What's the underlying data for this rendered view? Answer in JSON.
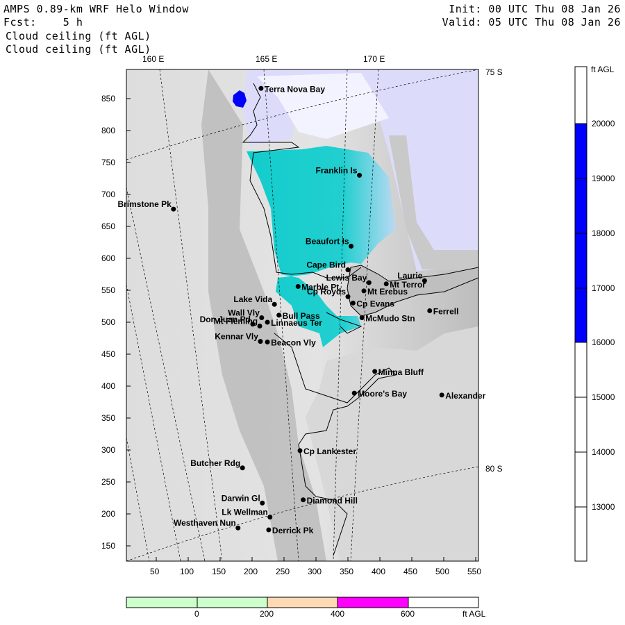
{
  "header": {
    "title": "AMPS 0.89-km WRF Helo Window",
    "forecast": "Fcst:    5 h",
    "field_line1": "Cloud ceiling (ft AGL)",
    "field_line2": "Cloud ceiling (ft AGL)",
    "init": "Init: 00 UTC Thu 08 Jan 26",
    "valid": "Valid: 05 UTC Thu 08 Jan 26"
  },
  "map": {
    "x_ticks": [
      "50",
      "100",
      "150",
      "200",
      "250",
      "300",
      "350",
      "400",
      "450",
      "500",
      "550"
    ],
    "y_ticks": [
      "850",
      "800",
      "750",
      "700",
      "650",
      "600",
      "550",
      "500",
      "450",
      "400",
      "350",
      "300",
      "250",
      "200",
      "150"
    ],
    "lon_labels": [
      "160 E",
      "165 E",
      "170 E"
    ],
    "lat_labels": [
      "75 S",
      "80 S"
    ],
    "places": [
      {
        "name": "Terra Nova Bay",
        "x": 214,
        "y": 866
      },
      {
        "name": "Franklin Is",
        "x": 368,
        "y": 730
      },
      {
        "name": "Brimstone Pk",
        "x": 77,
        "y": 677
      },
      {
        "name": "Beaufort Is",
        "x": 355,
        "y": 619
      },
      {
        "name": "Cape Bird",
        "x": 350,
        "y": 582
      },
      {
        "name": "Lewis Bay",
        "x": 383,
        "y": 562
      },
      {
        "name": "Laurie",
        "x": 470,
        "y": 565
      },
      {
        "name": "Mt Terror",
        "x": 410,
        "y": 560
      },
      {
        "name": "Marble Pt",
        "x": 272,
        "y": 556
      },
      {
        "name": "Mt Erebus",
        "x": 375,
        "y": 549
      },
      {
        "name": "Cp Royds",
        "x": 350,
        "y": 540
      },
      {
        "name": "Lake Vida",
        "x": 235,
        "y": 528
      },
      {
        "name": "Cp Evans",
        "x": 358,
        "y": 530
      },
      {
        "name": "Ferrell",
        "x": 478,
        "y": 518
      },
      {
        "name": "Wall Vly",
        "x": 215,
        "y": 507
      },
      {
        "name": "Bull Pass",
        "x": 242,
        "y": 511
      },
      {
        "name": "McMudo Stn",
        "x": 372,
        "y": 507
      },
      {
        "name": "Don Juan Pd",
        "x": 201,
        "y": 497
      },
      {
        "name": "Mt Fleming",
        "x": 212,
        "y": 494
      },
      {
        "name": "Linnaeus Ter",
        "x": 224,
        "y": 500
      },
      {
        "name": "Kennar Vly",
        "x": 213,
        "y": 470
      },
      {
        "name": "Beacon Vly",
        "x": 224,
        "y": 469
      },
      {
        "name": "Minna Bluff",
        "x": 392,
        "y": 423
      },
      {
        "name": "Moore's Bay",
        "x": 360,
        "y": 389
      },
      {
        "name": "Alexander",
        "x": 497,
        "y": 386
      },
      {
        "name": "Cp Lankester",
        "x": 275,
        "y": 299
      },
      {
        "name": "Butcher Rdg",
        "x": 185,
        "y": 272
      },
      {
        "name": "Darwin Gl",
        "x": 216,
        "y": 217
      },
      {
        "name": "Diamond Hill",
        "x": 280,
        "y": 222
      },
      {
        "name": "Lk Wellman",
        "x": 228,
        "y": 195
      },
      {
        "name": "Westhaven Nun",
        "x": 178,
        "y": 178
      },
      {
        "name": "Derrick Pk",
        "x": 226,
        "y": 175
      }
    ]
  },
  "colorbar": {
    "unit": "ft AGL",
    "ticks": [
      "20000",
      "19000",
      "18000",
      "17000",
      "16000",
      "15000",
      "14000",
      "13000"
    ],
    "band_color": "#0000ff"
  },
  "bottom_bar": {
    "ticks": [
      "0",
      "200",
      "400",
      "600"
    ],
    "unit": "ft AGL",
    "colors": [
      "#ccffcc",
      "#ccffcc",
      "#ffd9b3",
      "#ff00ff",
      "#ffffff"
    ]
  }
}
